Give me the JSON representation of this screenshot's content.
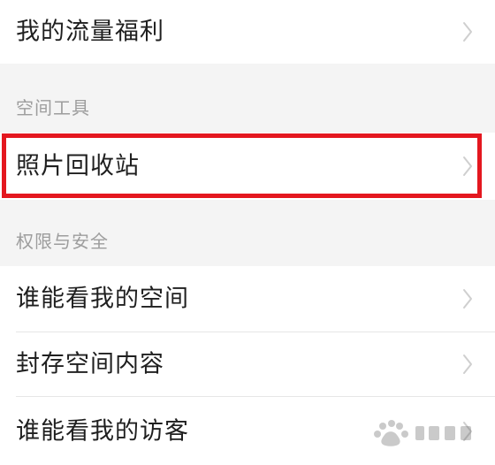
{
  "items": {
    "flow_benefit": "我的流量福利",
    "photo_recycle": "照片回收站",
    "who_can_view_space": "谁能看我的空间",
    "archive_space_content": "封存空间内容",
    "who_can_view_visitors": "谁能看我的访客"
  },
  "sections": {
    "space_tools": "空间工具",
    "permissions_security": "权限与安全"
  },
  "colors": {
    "highlight": "#e4171f",
    "section_background": "#f4f4f4",
    "section_text": "#9d9d9d",
    "row_text": "#1f1f1f",
    "chevron": "#cfcfcf"
  },
  "icons": {
    "chevron": "chevron-right-icon",
    "watermark": "baidu-jingyan-logo"
  }
}
